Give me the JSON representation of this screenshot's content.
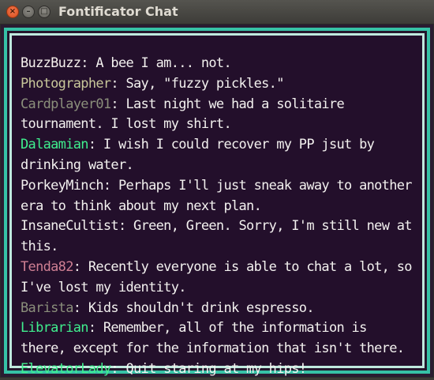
{
  "window": {
    "title": "Fontificator Chat",
    "buttons": {
      "close": "×",
      "minimize": "–",
      "maximize": "□"
    }
  },
  "theme": {
    "frame_outer": "#36c2a6",
    "frame_inner": "#bfe9de",
    "background": "#230f2b",
    "message_text": "#f3f1ef"
  },
  "chat": {
    "messages": [
      {
        "user": "BuzzBuzz",
        "color": "#f7f2ee",
        "text": ": A bee I am... not."
      },
      {
        "user": "Photographer",
        "color": "#c8c79a",
        "text": ": Say, \"fuzzy pickles.\""
      },
      {
        "user": "Cardplayer01",
        "color": "#8b8f7b",
        "text": ": Last night we had a solitaire tournament. I lost my shirt."
      },
      {
        "user": "Dalaamian",
        "color": "#3ff08e",
        "text": ": I wish I could recover my PP jsut by drinking water."
      },
      {
        "user": "PorkeyMinch",
        "color": "#f3f1ef",
        "text": ": Perhaps I'll just sneak away to another era to think about my next plan."
      },
      {
        "user": "InsaneCultist",
        "color": "#f3f1ef",
        "text": ": Green, Green. Sorry, I'm still new at this."
      },
      {
        "user": "Tenda82",
        "color": "#cf7f93",
        "text": ": Recently everyone is able to chat a lot, so I've lost my identity."
      },
      {
        "user": "Barista",
        "color": "#8b8f7b",
        "text": ": Kids shouldn't drink espresso."
      },
      {
        "user": "Librarian",
        "color": "#3ff08e",
        "text": ": Remember, all of the information is there, except for the information that isn't there."
      },
      {
        "user": "ElevatorLady",
        "color": "#3ff08e",
        "text": ": Quit staring at my hips!"
      }
    ]
  }
}
